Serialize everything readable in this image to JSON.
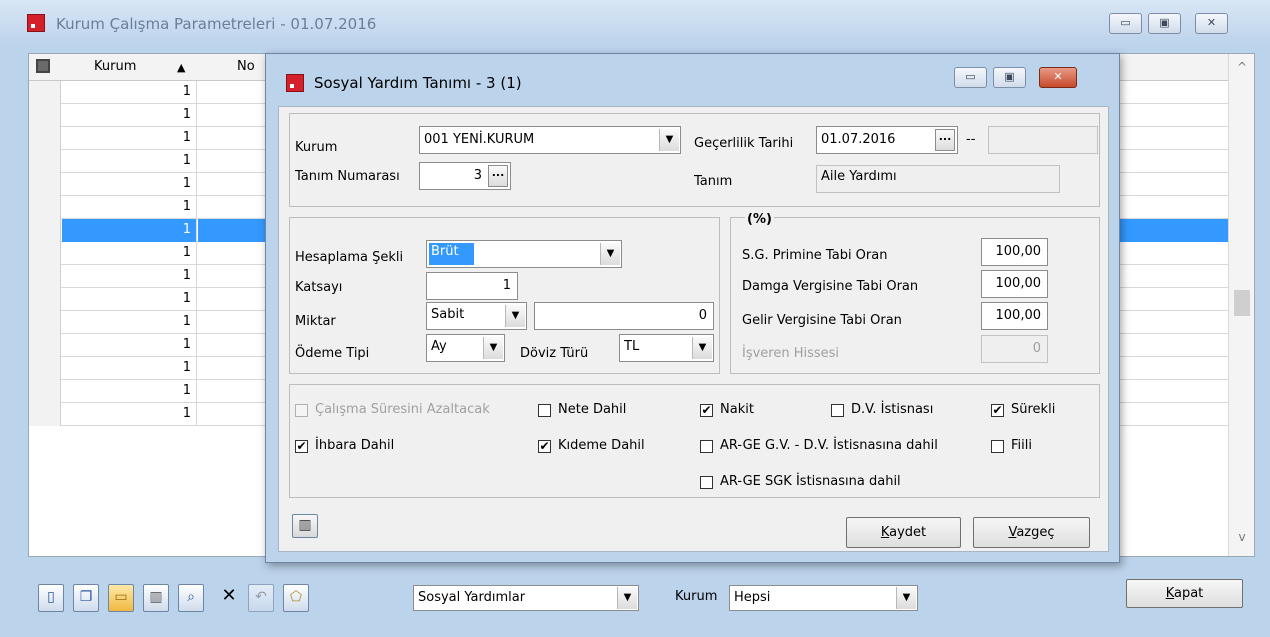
{
  "back_window": {
    "title": "Kurum Çalışma Parametreleri - 01.07.2016",
    "caption_buttons": {
      "minimize": "▭",
      "restore": "▣",
      "close": "✕"
    },
    "grid": {
      "col_kurum": "Kurum",
      "col_kurum_sort": "▲",
      "col_no": "No",
      "rows": [
        "1",
        "1",
        "1",
        "1",
        "1",
        "1",
        "1",
        "1",
        "1",
        "1",
        "1",
        "1",
        "1",
        "1",
        "1"
      ],
      "selected_row": 6
    },
    "scroll_up": "^",
    "scroll_down": "v"
  },
  "toolbar": {
    "icons": [
      "new-icon",
      "copy-icon",
      "open-folder-icon",
      "delete-icon",
      "preview-icon",
      "cancel-x-icon",
      "undo-icon",
      "shape-icon"
    ],
    "cancel_glyph": "✕",
    "undo_glyph": "↶",
    "list_combo_value": "Sosyal Yardımlar",
    "kurum_label": "Kurum",
    "kurum_combo_value": "Hepsi",
    "close_button": {
      "text_u": "K",
      "text_rest": "apat"
    }
  },
  "dialog": {
    "title": "Sosyal Yardım Tanımı - 3 (1)",
    "caption_buttons": {
      "minimize": "▭",
      "restore": "▣",
      "close": "✕"
    },
    "kurum_label": "Kurum",
    "kurum_value": "001 YENİ.KURUM",
    "gecerlilik_label": "Geçerlilik Tarihi",
    "gecerlilik_value": "01.07.2016",
    "dots": "...",
    "dash": "--",
    "tanim_no_label": "Tanım Numarası",
    "tanim_no_value": "3",
    "tanim_label": "Tanım",
    "tanim_value": "Aile Yardımı",
    "hesaplama_label": "Hesaplama Şekli",
    "hesaplama_value": "Brüt",
    "katsayi_label": "Katsayı",
    "katsayi_value": "1",
    "miktar_label": "Miktar",
    "miktar_type": "Sabit",
    "miktar_value": "0",
    "odeme_label": "Ödeme Tipi",
    "odeme_value": "Ay",
    "doviz_label": "Döviz Türü",
    "doviz_value": "TL",
    "percent_group": "(%)",
    "sg_label": "S.G. Primine Tabi Oran",
    "sg_value": "100,00",
    "damga_label": "Damga Vergisine Tabi Oran",
    "damga_value": "100,00",
    "gelir_label": "Gelir Vergisine Tabi Oran",
    "gelir_value": "100,00",
    "isveren_label": "İşveren Hissesi",
    "isveren_value": "0",
    "checkboxes": {
      "calisma": {
        "label": "Çalışma Süresini Azaltacak",
        "checked": false
      },
      "nete": {
        "label": "Nete Dahil",
        "checked": false
      },
      "nakit": {
        "label": "Nakit",
        "checked": true
      },
      "dv_istisnasi": {
        "label": "D.V. İstisnası",
        "checked": false
      },
      "surekli": {
        "label": "Sürekli",
        "checked": true
      },
      "ihbara": {
        "label": "İhbara Dahil",
        "checked": true
      },
      "kideme": {
        "label": "Kıdeme Dahil",
        "checked": true
      },
      "arge_gv": {
        "label": "AR-GE G.V. - D.V. İstisnasına dahil",
        "checked": false
      },
      "fiili": {
        "label": "Fiili",
        "checked": false
      },
      "arge_sgk": {
        "label": "AR-GE SGK İstisnasına dahil",
        "checked": false
      }
    },
    "check_glyph": "✔",
    "kaydet": {
      "u": "K",
      "rest": "aydet"
    },
    "vazgec": {
      "u": "V",
      "rest": "azgeç"
    }
  }
}
